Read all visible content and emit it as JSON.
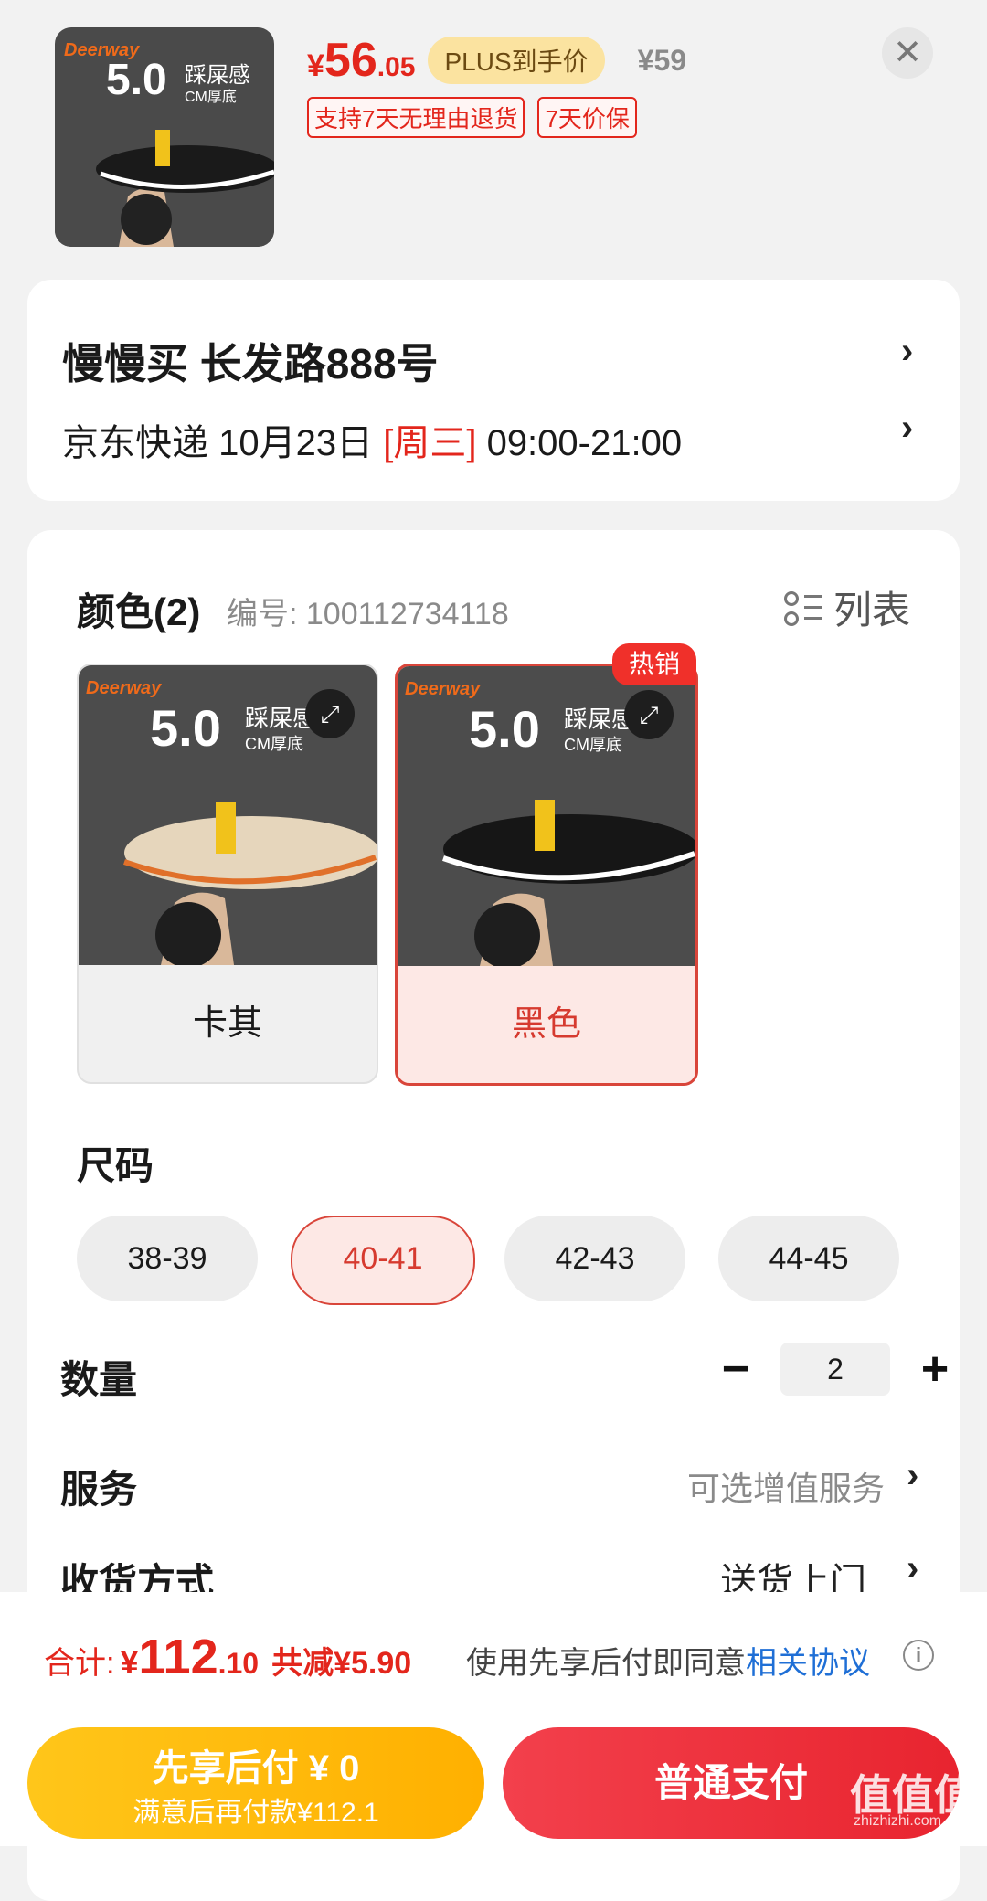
{
  "product": {
    "brand": "Deerway",
    "thumb_big": "5.0",
    "thumb_sub1": "踩屎感",
    "thumb_sub2": "CM厚底"
  },
  "price": {
    "currency": "¥",
    "integer": "56",
    "decimal": ".05",
    "plus_label": "PLUS到手价",
    "original": "¥59"
  },
  "tags": [
    "支持7天无理由退货",
    "7天价保"
  ],
  "address": {
    "line1": "慢慢买  长发路888号",
    "delivery_prefix": "京东快递 10月23日 ",
    "delivery_day": "[周三]",
    "delivery_time": " 09:00-21:00"
  },
  "color": {
    "title": "颜色(2)",
    "sku": "编号: 100112734118",
    "list_label": "列表",
    "hot_badge": "热销",
    "options": [
      {
        "label": "卡其",
        "selected": false
      },
      {
        "label": "黑色",
        "selected": true
      }
    ]
  },
  "size": {
    "title": "尺码",
    "options": [
      {
        "label": "38-39",
        "selected": false
      },
      {
        "label": "40-41",
        "selected": true
      },
      {
        "label": "42-43",
        "selected": false
      },
      {
        "label": "44-45",
        "selected": false
      }
    ]
  },
  "quantity": {
    "label": "数量",
    "minus": "−",
    "value": "2",
    "plus": "+"
  },
  "service": {
    "label": "服务",
    "value": "可选增值服务"
  },
  "delivery_method": {
    "label": "收货方式",
    "value": "送货上门"
  },
  "total": {
    "label": "合计: ",
    "currency": "¥",
    "integer": "112",
    "decimal": ".10",
    "reduced": "共减¥5.90",
    "agree_text": "使用先享后付即同意",
    "agree_link": "相关协议"
  },
  "actions": {
    "later_line1": "先享后付 ¥ 0",
    "later_line2": "满意后再付款¥112.1",
    "pay": "普通支付"
  },
  "watermark": {
    "text": "值值值",
    "sub": "zhizhizhi.com"
  },
  "icons": {
    "close": "close-icon",
    "chevron": "chevron-right-icon",
    "expand": "expand-icon",
    "list": "list-icon",
    "info": "info-icon"
  },
  "colors": {
    "accent": "#e3261c",
    "plus_pill": "#fbe3a0",
    "later_btn": "#ffb000",
    "pay_btn": "#e8242f",
    "link": "#1f6fd6"
  }
}
